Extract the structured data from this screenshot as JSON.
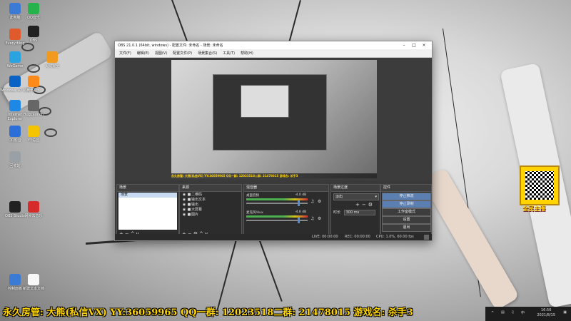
{
  "desktop": {
    "icons": [
      {
        "label": "此电脑"
      },
      {
        "label": "QQ音乐"
      },
      {
        "label": "OBS"
      },
      {
        "label": "Everything"
      },
      {
        "label": "火绒安全"
      },
      {
        "label": "WeGame"
      },
      {
        "label": "Windows 10 易升"
      },
      {
        "label": "腾讯视频"
      },
      {
        "label": "Internet Explorer"
      },
      {
        "label": "BugLaunch"
      },
      {
        "label": "QQ影音"
      },
      {
        "label": "YY语音"
      },
      {
        "label": "回收站"
      },
      {
        "label": "OBS Studio"
      },
      {
        "label": "网易云音乐"
      },
      {
        "label": "控制面板"
      },
      {
        "label": "新建文本文档"
      }
    ]
  },
  "obs": {
    "title": "OBS 21.0.1 (64bit, windows) - 配置文件: 未命名 - 场景: 未命名",
    "menu": [
      "文件(F)",
      "编辑(E)",
      "视图(V)",
      "配置文件(P)",
      "场景集合(S)",
      "工具(T)",
      "帮助(H)"
    ],
    "preview_banner": "永久房管: 大熊(私信VX)  YY:36059965  QQ一群: 12023518二群: 21478015  游戏名: 杀手3",
    "docks": {
      "scenes": {
        "title": "场景",
        "items": [
          "场景"
        ]
      },
      "sources": {
        "title": "来源",
        "items": [
          "二维码",
          "输出文本",
          "输出",
          "大屏幕",
          "图片"
        ]
      },
      "mixer": {
        "title": "混音器",
        "channels": [
          {
            "name": "桌面音频",
            "db": "-4.0 dB"
          },
          {
            "name": "麦克风/Aux",
            "db": "-4.6 dB"
          }
        ]
      },
      "transitions": {
        "title": "场景过渡",
        "type": "淡出",
        "duration_label": "时长",
        "duration": "300 ms"
      },
      "controls": {
        "title": "控件",
        "buttons": [
          "停止推流",
          "停止录制",
          "工作室模式",
          "设置",
          "退出"
        ]
      }
    },
    "status": {
      "live": "LIVE: 00:00:00",
      "rec": "REC: 00:00:00",
      "cpu": "CPU: 1.0%, 60.00 fps"
    }
  },
  "overlay": {
    "banner": "永久房管: 大熊(私信VX)  YY:36059965  QQ一群: 12023518二群: 21478015  游戏名: 杀手3",
    "qr_caption": "全民主播"
  },
  "taskbar": {
    "time": "16:56",
    "date": "2021/8/15"
  },
  "colors": {
    "banner_text": "#ffd400",
    "obs_background": "#3a3a3a",
    "active_button": "#5b7fb0"
  }
}
